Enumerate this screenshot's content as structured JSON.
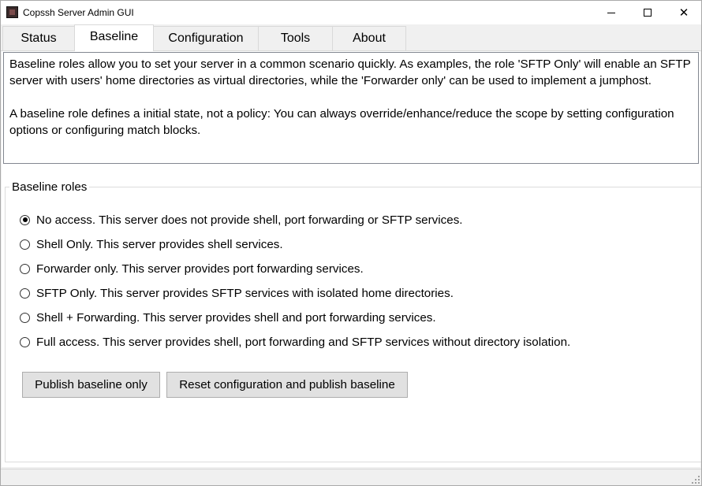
{
  "window": {
    "title": "Copssh Server Admin GUI",
    "icons": {
      "app": "copssh-app-icon",
      "minimize": "minimize-icon",
      "maximize": "maximize-icon",
      "close": "close-icon"
    },
    "close_glyph": "✕"
  },
  "tabs": [
    {
      "label": "Status",
      "active": false
    },
    {
      "label": "Baseline",
      "active": true
    },
    {
      "label": "Configuration",
      "active": false
    },
    {
      "label": "Tools",
      "active": false
    },
    {
      "label": "About",
      "active": false
    }
  ],
  "description": {
    "paragraph1": "Baseline roles allow you to set your server in a common scenario quickly. As examples, the role 'SFTP Only' will enable an SFTP server with users' home directories as virtual directories, while the 'Forwarder only' can be used to implement a jumphost.",
    "paragraph2": "A baseline role defines a initial state, not a policy: You can always override/enhance/reduce the scope by setting configuration options or configuring match blocks."
  },
  "baseline_roles": {
    "legend": "Baseline roles",
    "selected": "No access. This server does not provide shell, port forwarding or SFTP services.",
    "options": [
      {
        "label": "No access. This server does not provide shell, port forwarding or SFTP services.",
        "checked": true
      },
      {
        "label": "Shell Only. This server provides shell services.",
        "checked": false
      },
      {
        "label": "Forwarder only. This server provides port forwarding services.",
        "checked": false
      },
      {
        "label": "SFTP Only. This server provides SFTP services with isolated home directories.",
        "checked": false
      },
      {
        "label": "Shell + Forwarding. This server provides shell and port forwarding services.",
        "checked": false
      },
      {
        "label": "Full access. This server provides shell, port forwarding and SFTP services without directory isolation.",
        "checked": false
      }
    ]
  },
  "buttons": {
    "publish_baseline_only": "Publish baseline only",
    "reset_and_publish": "Reset configuration and publish baseline"
  },
  "statusbar": {
    "grip_icon": "resize-grip-icon"
  }
}
